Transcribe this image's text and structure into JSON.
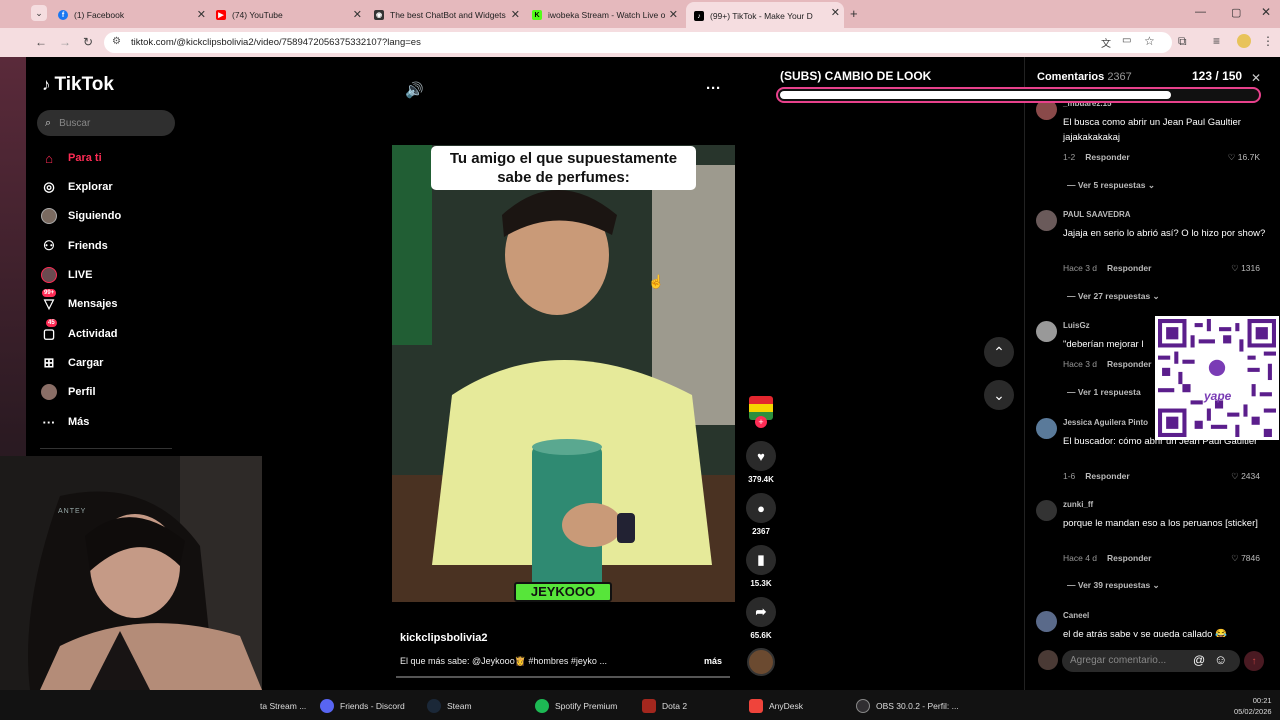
{
  "browser": {
    "tabs": [
      {
        "label": "(1) Facebook",
        "icon": "facebook-icon",
        "color": "#1877f2"
      },
      {
        "label": "(74) YouTube",
        "icon": "youtube-icon",
        "color": "#ff0000"
      },
      {
        "label": "The best ChatBot and Widgets",
        "icon": "chatbot-icon",
        "color": "#333333"
      },
      {
        "label": "iwobeka Stream - Watch Live o",
        "icon": "kick-icon",
        "color": "#53fc18"
      },
      {
        "label": "(99+) TikTok - Make Your D",
        "icon": "tiktok-icon",
        "color": "#000000"
      }
    ],
    "url": "tiktok.com/@kickclipsbolivia2/video/7589472056375332107?lang=es"
  },
  "tiktok": {
    "logo": "TikTok",
    "search_placeholder": "Buscar",
    "nav": [
      {
        "label": "Para ti",
        "icon": "home-icon",
        "active": true
      },
      {
        "label": "Explorar",
        "icon": "compass-icon"
      },
      {
        "label": "Siguiendo",
        "icon": "following-avatar-icon"
      },
      {
        "label": "Friends",
        "icon": "friends-icon"
      },
      {
        "label": "LIVE",
        "icon": "live-icon"
      },
      {
        "label": "Mensajes",
        "icon": "messages-icon",
        "badge": "99+"
      },
      {
        "label": "Actividad",
        "icon": "activity-icon",
        "badge": "45"
      },
      {
        "label": "Cargar",
        "icon": "upload-icon"
      },
      {
        "label": "Perfil",
        "icon": "profile-icon"
      },
      {
        "label": "Más",
        "icon": "more-icon"
      }
    ],
    "video": {
      "caption": "Tu amigo el que supuestamente sabe de perfumes:",
      "watermark": "JEYKOOO",
      "author": "kickclipsbolivia2",
      "description": "El que más sabe: @Jeykooo👸 #hombres #jeyko ...",
      "more": "más"
    },
    "actions": {
      "likes": "379.4K",
      "comments": "2367",
      "saves": "15.3K",
      "shares": "65.6K"
    }
  },
  "goal": {
    "title": "(SUBS) CAMBIO DE LOOK",
    "current": "123",
    "sep": "/",
    "target": "150",
    "progress": 0.82
  },
  "comments": {
    "title": "Comentarios",
    "count": "2367",
    "reply_label": "Responder",
    "input_placeholder": "Agregar comentario...",
    "items": [
      {
        "name": "_mbuarez.15",
        "text": "El busca como abrir un Jean Paul Gaultier jajakakakakaj",
        "time": "1-2",
        "likes": "16.7K",
        "replies": "Ver 5 respuestas"
      },
      {
        "name": "PAUL SAAVEDRA",
        "text": "Jajaja en serio lo abrió así? O lo hizo por show?",
        "time": "Hace 3 d",
        "likes": "1316",
        "replies": "Ver 27 respuestas"
      },
      {
        "name": "LuisGz",
        "text": "\"deberían mejorar l",
        "time": "Hace 3 d",
        "likes": "",
        "replies": "Ver 1 respuesta"
      },
      {
        "name": "Jessica Aguilera Pinto",
        "text": "El buscador: cómo abrir un Jean Paul Gaultier",
        "time": "1-6",
        "likes": "2434",
        "replies": ""
      },
      {
        "name": "zunki_ff",
        "text": "porque le mandan eso a los peruanos [sticker]",
        "time": "Hace 4 d",
        "likes": "7846",
        "replies": "Ver 39 respuestas"
      },
      {
        "name": "Caneel",
        "text": "el de atrás sabe y se queda callado 😂",
        "time": "",
        "likes": "",
        "replies": ""
      }
    ]
  },
  "qr_brand": "yape",
  "webcam_text": "ANTEY",
  "taskbar": {
    "items": [
      {
        "label": "ta Stream ...",
        "icon": "browser-icon"
      },
      {
        "label": "Friends - Discord",
        "icon": "discord-icon"
      },
      {
        "label": "Steam",
        "icon": "steam-icon"
      },
      {
        "label": "Spotify Premium",
        "icon": "spotify-icon"
      },
      {
        "label": "Dota 2",
        "icon": "dota-icon"
      },
      {
        "label": "AnyDesk",
        "icon": "anydesk-icon"
      },
      {
        "label": "OBS 30.0.2 - Perfil: ...",
        "icon": "obs-icon"
      }
    ],
    "time": "00:21",
    "date": "05/02/2026"
  }
}
